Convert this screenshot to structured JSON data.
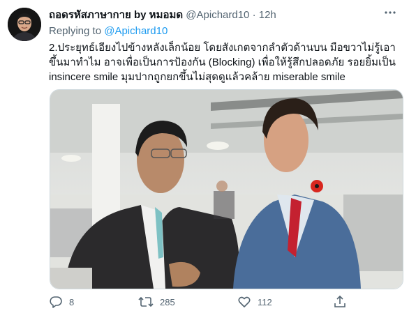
{
  "tweet": {
    "display_name": "ถอดรหัสภาษากาย by หมอมด",
    "handle": "@Apichard10",
    "separator": "·",
    "time": "12h",
    "more_icon": "ellipsis-icon",
    "replying_to_label": "Replying to",
    "replying_to_handle": "@Apichard10",
    "text": "2.ประยุทธ์เอียงไปข้างหลังเล็กน้อย โดยสังเกตจากลำตัวด้านบน มือขวาไม่รู้เอาขึ้นมาทำไม อาจเพื่อเป็นการป้องกัน (Blocking) เพื่อให้รู้สึกปลอดภัย รอยยิ้มเป็น insincere smile มุมปากถูกยกขึ้นไม่สุดดูแล้วคล้าย miserable smile"
  },
  "actions": {
    "reply_icon": "reply-icon",
    "reply_count": "8",
    "retweet_icon": "retweet-icon",
    "retweet_count": "285",
    "like_icon": "heart-icon",
    "like_count": "112",
    "share_icon": "share-icon"
  },
  "colors": {
    "accent": "#1d9bf0",
    "secondary_text": "#536471",
    "primary_text": "#0f1419"
  }
}
